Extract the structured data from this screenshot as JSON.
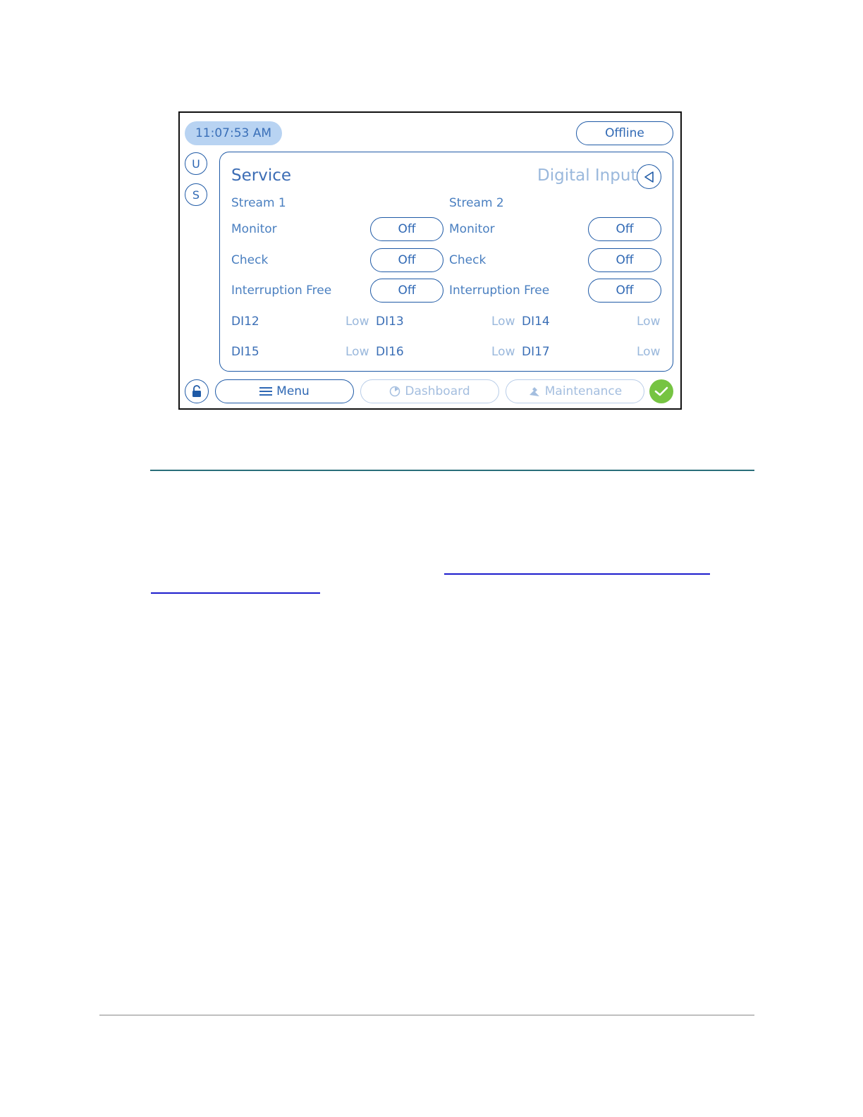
{
  "status": {
    "time": "11:07:53 AM",
    "connection": "Offline"
  },
  "side": {
    "u": "U",
    "s": "S"
  },
  "panel": {
    "title": "Service",
    "subtitle": "Digital Input",
    "stream1": {
      "label": "Stream 1",
      "rows": [
        {
          "label": "Monitor",
          "value": "Off"
        },
        {
          "label": "Check",
          "value": "Off"
        },
        {
          "label": "Interruption Free",
          "value": "Off"
        }
      ]
    },
    "stream2": {
      "label": "Stream 2",
      "rows": [
        {
          "label": "Monitor",
          "value": "Off"
        },
        {
          "label": "Check",
          "value": "Off"
        },
        {
          "label": "Interruption Free",
          "value": "Off"
        }
      ]
    },
    "inputs": [
      {
        "name": "DI12",
        "state": "Low"
      },
      {
        "name": "DI13",
        "state": "Low"
      },
      {
        "name": "DI14",
        "state": "Low"
      },
      {
        "name": "DI15",
        "state": "Low"
      },
      {
        "name": "DI16",
        "state": "Low"
      },
      {
        "name": "DI17",
        "state": "Low"
      }
    ]
  },
  "nav": {
    "menu": "Menu",
    "dashboard": "Dashboard",
    "maintenance": "Maintenance"
  },
  "colors": {
    "accent": "#1f5aa6",
    "time_bg": "#b8d3f2",
    "ok_green": "#76c442"
  },
  "icons": [
    "back-arrow-icon",
    "unlock-icon",
    "menu-icon",
    "dashboard-icon",
    "maintenance-icon",
    "check-icon"
  ]
}
